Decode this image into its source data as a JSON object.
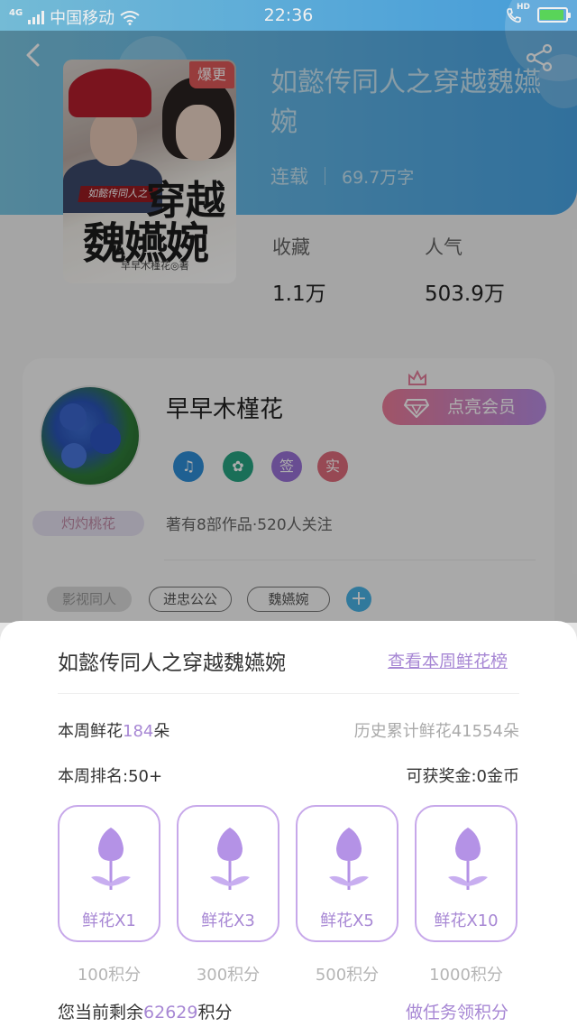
{
  "status_bar": {
    "network": "4G",
    "carrier": "中国移动",
    "time": "22:36",
    "call_label": "HD"
  },
  "book": {
    "title": "如懿传同人之穿越魏嬿婉",
    "status": "连载",
    "word_count": "69.7万字",
    "cover": {
      "badge": "爆更",
      "subtitle": "如懿传同人之",
      "title_line1": "穿越",
      "title_line2": "魏嬿婉",
      "author": "早早木槿花◎著"
    },
    "stats": {
      "favorites_label": "收藏",
      "favorites_value": "1.1万",
      "popularity_label": "人气",
      "popularity_value": "503.9万"
    }
  },
  "author": {
    "name": "早早木槿花",
    "vip_button": "点亮会员",
    "name_tag": "灼灼桃花",
    "badges": [
      "♫",
      "✿",
      "签",
      "实"
    ],
    "works_summary": "著有8部作品·520人关注",
    "tags": [
      "影视同人",
      "进忠公公",
      "魏嬿婉"
    ],
    "add_tag": "+"
  },
  "flower_sheet": {
    "title": "如懿传同人之穿越魏嬿婉",
    "rank_link": "查看本周鲜花榜",
    "weekly_prefix": "本周鲜花",
    "weekly_count": "184",
    "weekly_suffix": "朵",
    "history_total": "历史累计鲜花41554朵",
    "weekly_rank": "本周排名:50+",
    "reward": "可获奖金:0金币",
    "options": [
      {
        "label": "鲜花X1",
        "cost": "100积分"
      },
      {
        "label": "鲜花X3",
        "cost": "300积分"
      },
      {
        "label": "鲜花X5",
        "cost": "500积分"
      },
      {
        "label": "鲜花X10",
        "cost": "1000积分"
      }
    ],
    "remaining_prefix": "您当前剩余",
    "remaining_points": "62629",
    "remaining_suffix": "积分",
    "task_link": "做任务领积分"
  },
  "colors": {
    "accent_purple": "#a787d4",
    "header_blue": "#4aa6e6",
    "vip_gradient_start": "#ec7d9a",
    "vip_gradient_end": "#b98ee5"
  }
}
